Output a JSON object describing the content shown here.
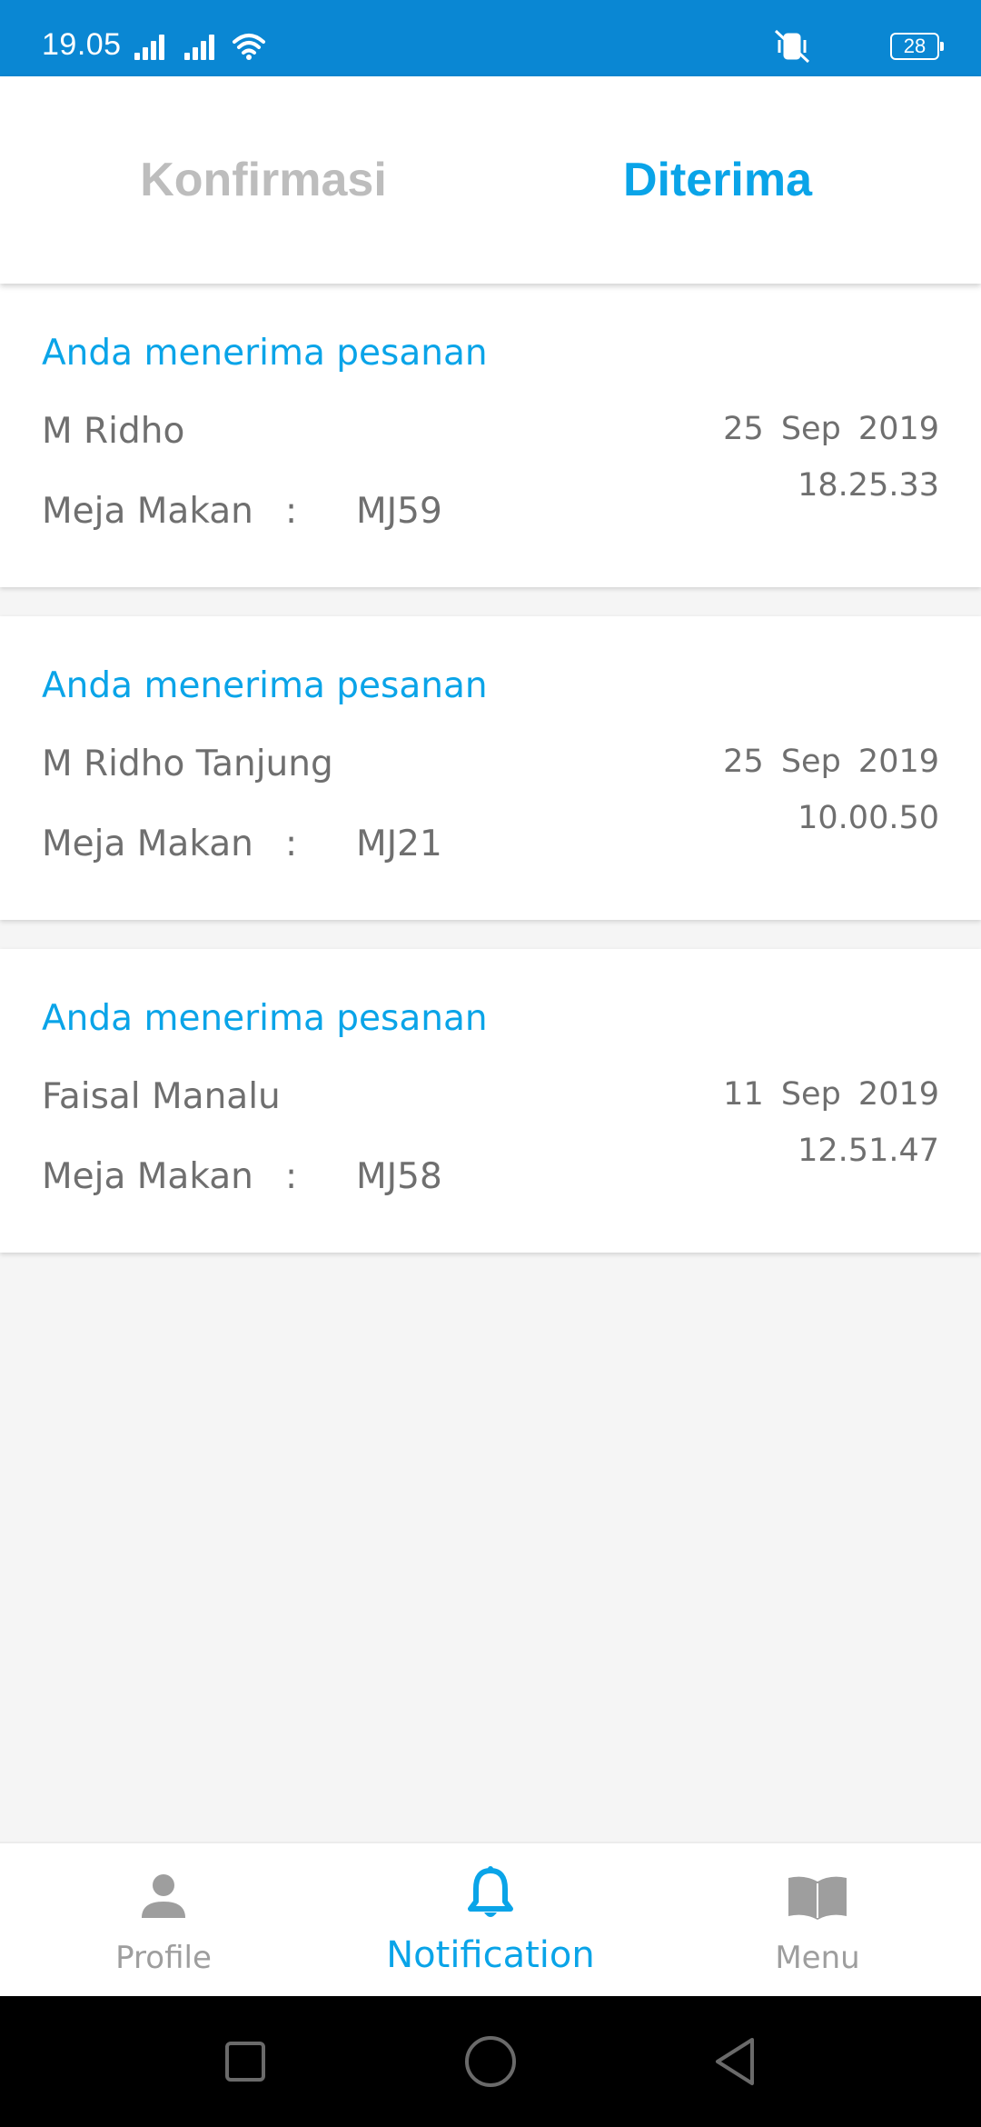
{
  "status_bar": {
    "time": "19.05",
    "battery": "28",
    "background_color": "#0a87d3"
  },
  "tabs": [
    {
      "label": "Konfirmasi",
      "active": false
    },
    {
      "label": "Diterima",
      "active": true
    }
  ],
  "notifications": [
    {
      "title": "Anda menerima pesanan",
      "name": "M Ridho",
      "table_label": "Meja Makan",
      "table_separator": ":",
      "table_value": "MJ59",
      "date": "25 Sep 2019",
      "time": "18.25.33"
    },
    {
      "title": "Anda menerima pesanan",
      "name": "M Ridho Tanjung",
      "table_label": "Meja Makan",
      "table_separator": ":",
      "table_value": "MJ21",
      "date": "25 Sep 2019",
      "time": "10.00.50"
    },
    {
      "title": "Anda menerima pesanan",
      "name": "Faisal Manalu",
      "table_label": "Meja Makan",
      "table_separator": ":",
      "table_value": "MJ58",
      "date": "11 Sep 2019",
      "time": "12.51.47"
    }
  ],
  "bottom_nav": [
    {
      "label": "Profile",
      "icon": "person-icon",
      "active": false
    },
    {
      "label": "Notification",
      "icon": "bell-icon",
      "active": true
    },
    {
      "label": "Menu",
      "icon": "book-icon",
      "active": false
    }
  ],
  "colors": {
    "accent": "#0aa4e8",
    "inactive": "#bdbdbd",
    "text": "#6f6f6f"
  }
}
